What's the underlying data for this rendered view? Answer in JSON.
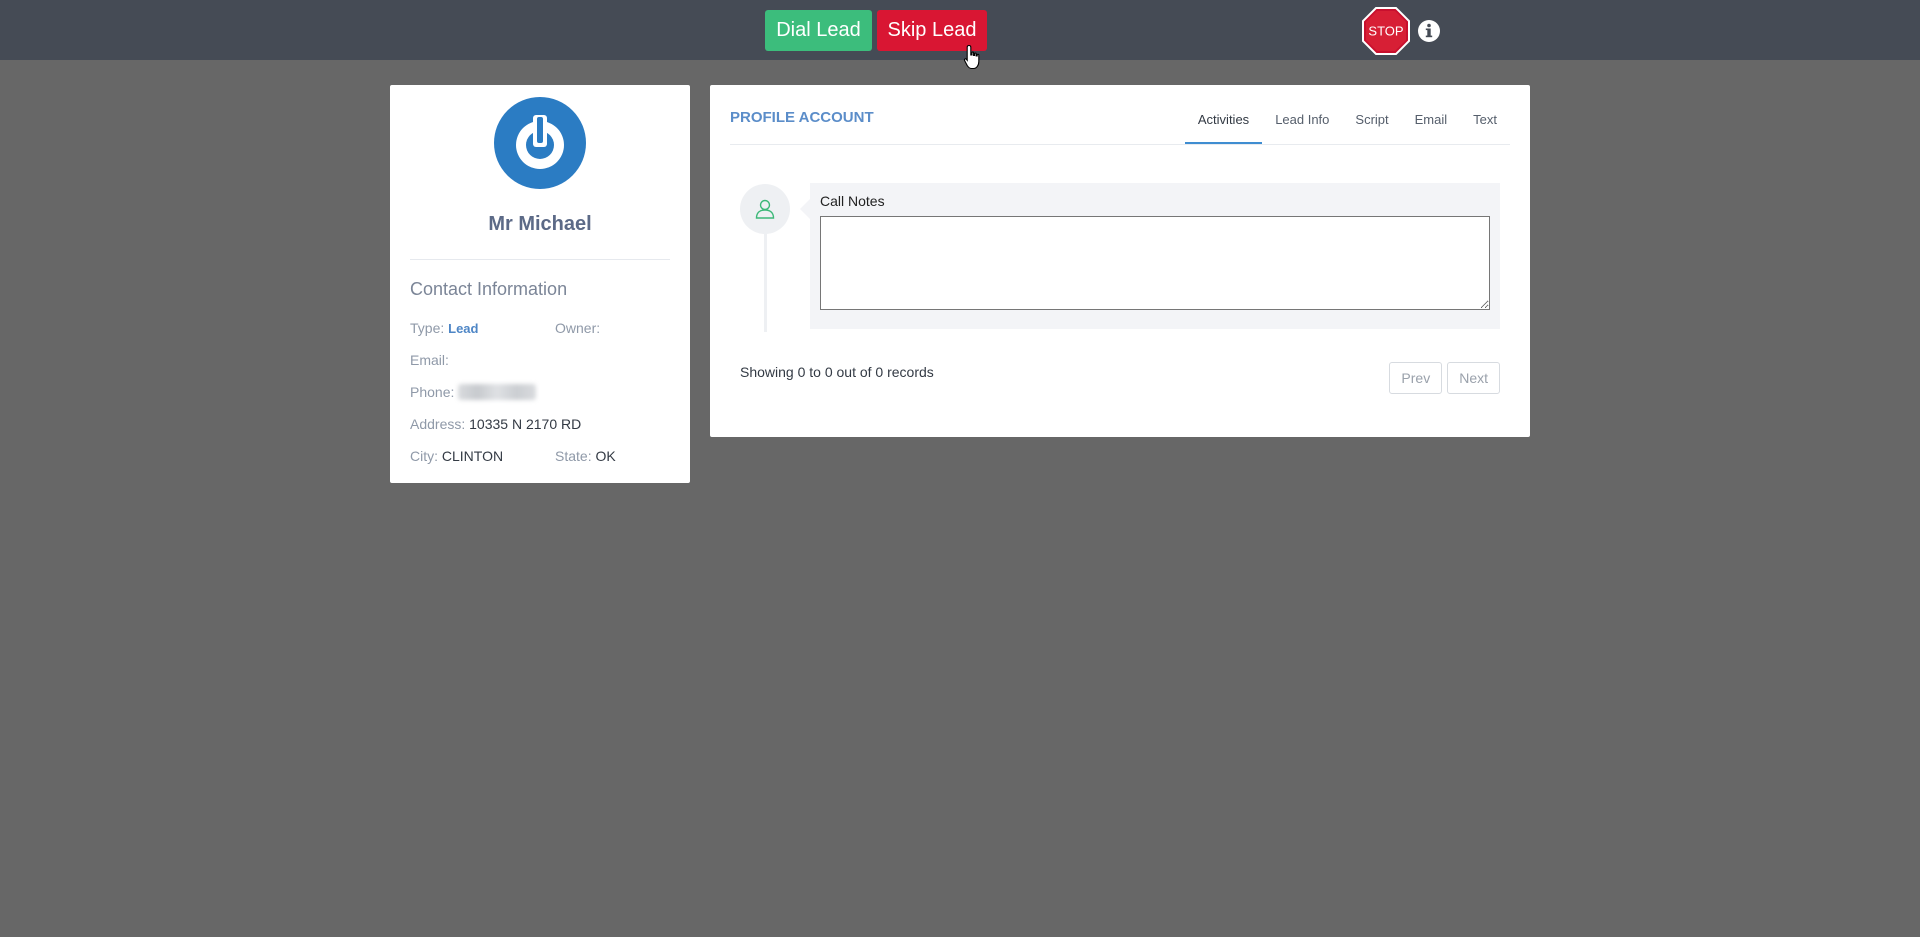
{
  "topbar": {
    "dial_label": "Dial Lead",
    "skip_label": "Skip Lead",
    "stop_label": "STOP"
  },
  "colors": {
    "topbar_bg": "#454b55",
    "page_bg": "#676767",
    "dial": "#3cbd7c",
    "skip": "#d91633",
    "accent": "#3f8dd1"
  },
  "contact": {
    "name": "Mr Michael",
    "section_title": "Contact Information",
    "type_label": "Type:",
    "type_value": "Lead",
    "owner_label": "Owner:",
    "owner_value": "",
    "email_label": "Email:",
    "email_value": "",
    "phone_label": "Phone:",
    "address_label": "Address:",
    "address_value": "10335 N 2170 RD",
    "city_label": "City:",
    "city_value": "CLINTON",
    "state_label": "State:",
    "state_value": "OK"
  },
  "profile": {
    "title": "PROFILE ACCOUNT",
    "tabs": [
      {
        "label": "Activities",
        "active": true
      },
      {
        "label": "Lead Info",
        "active": false
      },
      {
        "label": "Script",
        "active": false
      },
      {
        "label": "Email",
        "active": false
      },
      {
        "label": "Text",
        "active": false
      }
    ],
    "notes_label": "Call Notes",
    "notes_value": "",
    "records_text": "Showing 0 to 0 out of 0 records",
    "prev_label": "Prev",
    "next_label": "Next"
  }
}
